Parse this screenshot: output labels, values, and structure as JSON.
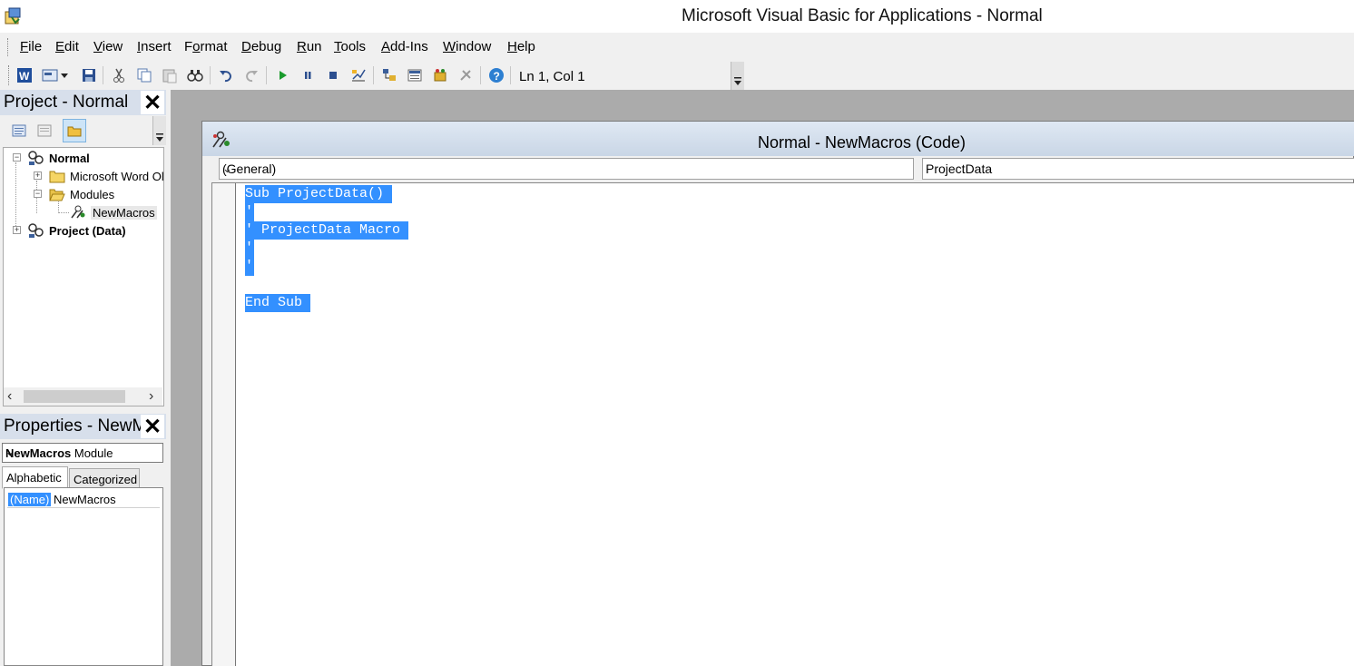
{
  "window": {
    "title": "Microsoft Visual Basic for Applications - Normal"
  },
  "menu": [
    {
      "label": "File",
      "accel": "F",
      "rest": "ile"
    },
    {
      "label": "Edit",
      "accel": "E",
      "rest": "dit"
    },
    {
      "label": "View",
      "accel": "V",
      "rest": "iew"
    },
    {
      "label": "Insert",
      "accel": "I",
      "rest": "nsert"
    },
    {
      "label": "Format",
      "accel": "o",
      "pre": "F",
      "rest": "rmat"
    },
    {
      "label": "Debug",
      "accel": "D",
      "rest": "ebug"
    },
    {
      "label": "Run",
      "accel": "R",
      "rest": "un"
    },
    {
      "label": "Tools",
      "accel": "T",
      "rest": "ools"
    },
    {
      "label": "Add-Ins",
      "accel": "A",
      "rest": "dd-Ins"
    },
    {
      "label": "Window",
      "accel": "W",
      "rest": "indow"
    },
    {
      "label": "Help",
      "accel": "H",
      "rest": "elp"
    }
  ],
  "toolbar": {
    "cursor_position": "Ln 1, Col 1"
  },
  "project_pane": {
    "title": "Project - Normal",
    "tree": [
      {
        "label": "Normal",
        "bold": true
      },
      {
        "label": "Microsoft Word Ol"
      },
      {
        "label": "Modules"
      },
      {
        "label": "NewMacros"
      },
      {
        "label": "Project (Data)",
        "bold": true
      }
    ]
  },
  "properties_pane": {
    "title": "Properties - NewM",
    "object_name": "NewMacros",
    "object_type": " Module",
    "tabs": [
      "Alphabetic",
      "Categorized"
    ],
    "rows": [
      {
        "name": "(Name)",
        "value": "NewMacros"
      }
    ]
  },
  "code_window": {
    "title": "Normal - NewMacros (Code)",
    "object_combo": "(General)",
    "procedure_combo": "ProjectData",
    "lines": [
      "Sub ProjectData() ",
      "'",
      "' ProjectData Macro ",
      "'",
      "'",
      "",
      "End Sub "
    ]
  },
  "colors": {
    "selection": "#3390ff",
    "mdi_background": "#ababab",
    "pane_title": "#d7dfeb"
  }
}
